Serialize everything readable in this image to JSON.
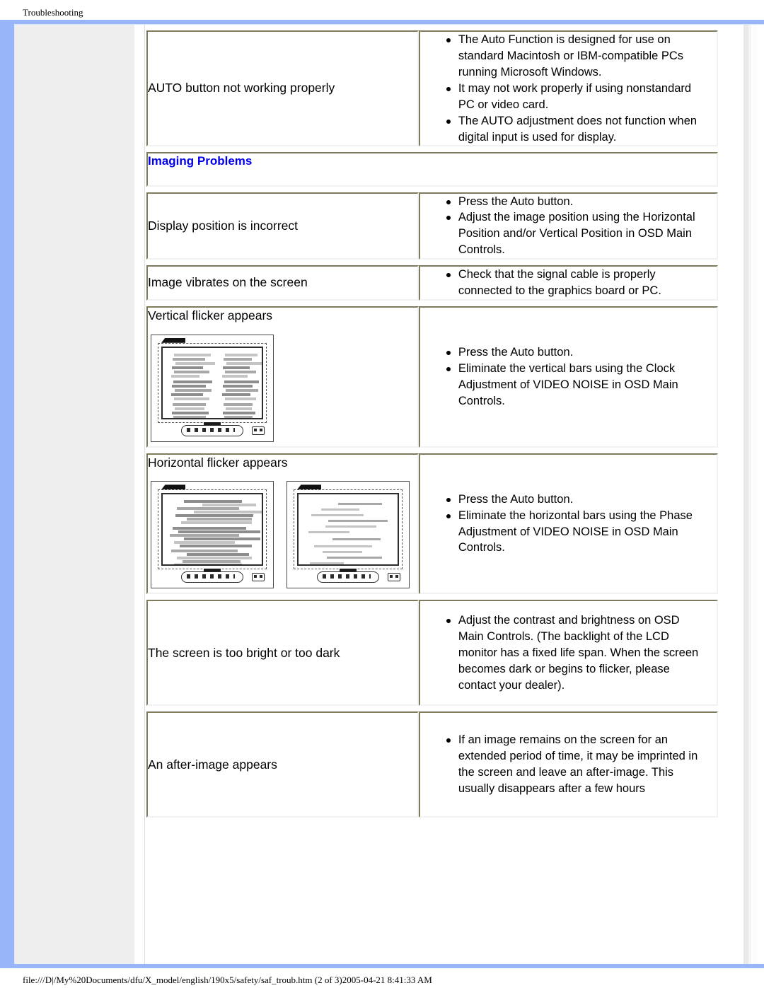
{
  "header": {
    "title": "Troubleshooting"
  },
  "footer": {
    "path": "file:///D|/My%20Documents/dfu/X_model/english/190x5/safety/saf_troub.htm (2 of 3)2005-04-21 8:41:33 AM"
  },
  "colors": {
    "frame_blue": "#99b5f9",
    "sidebar_gray": "#eeeeee",
    "section_link_blue": "#0000ee",
    "cell_border": "#7d7a5e"
  },
  "rows": [
    {
      "symptom": "AUTO button not working properly",
      "fixes": [
        "The Auto Function is designed for use on standard Macintosh or IBM-compatible PCs running Microsoft Windows.",
        "It may not work properly if using nonstandard PC or video card.",
        "The AUTO adjustment does not function when digital input is used for display."
      ]
    },
    {
      "symptom": "Display position is incorrect",
      "fixes": [
        "Press the Auto button.",
        "Adjust the image position using the Horizontal Position and/or Vertical Position in OSD Main Controls."
      ]
    },
    {
      "symptom": "Image vibrates on the screen",
      "fixes": [
        "Check that the signal cable is properly connected to the graphics board or PC."
      ]
    },
    {
      "symptom": "Vertical flicker appears",
      "fixes": [
        "Press the Auto button.",
        "Eliminate the vertical bars using the Clock Adjustment of VIDEO NOISE in OSD Main Controls."
      ]
    },
    {
      "symptom": "Horizontal flicker appears",
      "fixes": [
        "Press the Auto button.",
        "Eliminate the horizontal bars using the Phase Adjustment of VIDEO NOISE in OSD Main Controls."
      ]
    },
    {
      "symptom": "The screen is too bright or too dark",
      "fixes": [
        "Adjust the contrast and brightness on OSD Main Controls. (The backlight of the LCD monitor has a fixed life span. When the screen becomes dark or begins to flicker, please contact your dealer)."
      ]
    },
    {
      "symptom": "An after-image appears",
      "fixes": [
        "If an image remains on the screen for an extended period of time, it may be imprinted in the screen and leave an after-image. This usually disappears after a few hours"
      ]
    }
  ],
  "section": {
    "imaging_problems": "Imaging Problems"
  },
  "illustrations": {
    "vertical_flicker": "monitor-with-vertical-noise-bars",
    "horizontal_flicker_left": "monitor-with-heavy-horizontal-noise-bars",
    "horizontal_flicker_right": "monitor-with-light-horizontal-noise-bars"
  }
}
